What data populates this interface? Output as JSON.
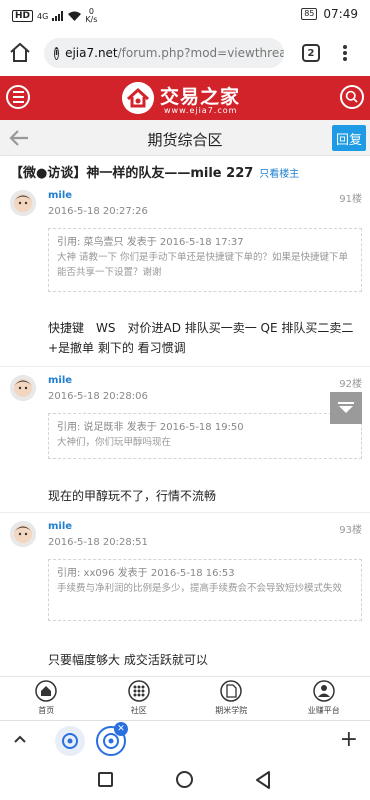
{
  "status_bar": {
    "network": "HD",
    "signal": "4G",
    "speed_value": "0",
    "speed_unit": "K/s",
    "battery": "85",
    "time": "07:49"
  },
  "browser": {
    "url_domain": "ejia7.net",
    "url_path": "/forum.php?mod=viewthread&",
    "tab_count": "2"
  },
  "site_header": {
    "logo_name": "交易之家",
    "logo_sub": "www.ejia7.com"
  },
  "title_bar": {
    "title": "期货综合区",
    "reply_label": "回复"
  },
  "thread": {
    "title": "【微●访谈】神一样的队友——mile 227",
    "only_author": "只看楼主"
  },
  "posts": [
    {
      "author": "mile",
      "floor": "91楼",
      "time": "2016-5-18 20:27:26",
      "quote_head": "引用: 菜鸟壹只 发表于 2016-5-18 17:37",
      "quote_text": "大神 请教一下 你们是手动下单还是快捷键下单的？如果是快捷键下单 能否共享一下设置？谢谢",
      "body": "快捷键　WS　对价进AD 排队买一卖一 QE 排队买二卖二　+是撤单 剩下的 看习惯调"
    },
    {
      "author": "mile",
      "floor": "92楼",
      "time": "2016-5-18 20:28:06",
      "quote_head": "引用: 说足既非 发表于 2016-5-18 19:50",
      "quote_text": "大神们，你们玩甲醇吗现在",
      "body": "现在的甲醇玩不了，行情不流畅"
    },
    {
      "author": "mile",
      "floor": "93楼",
      "time": "2016-5-18 20:28:51",
      "quote_head": "引用: xx096 发表于 2016-5-18 16:53",
      "quote_text": "手续费与净利润的比例是多少，提高手续费会不会导致短炒模式失效",
      "body": "只要幅度够大 成交活跃就可以"
    }
  ],
  "site_bottom_nav": [
    {
      "label": "首页",
      "icon": "home-icon"
    },
    {
      "label": "社区",
      "icon": "grid-icon"
    },
    {
      "label": "期米学院",
      "icon": "document-icon"
    },
    {
      "label": "业赚平台",
      "icon": "user-icon"
    }
  ],
  "browser_tabs": {
    "plus": "+"
  }
}
